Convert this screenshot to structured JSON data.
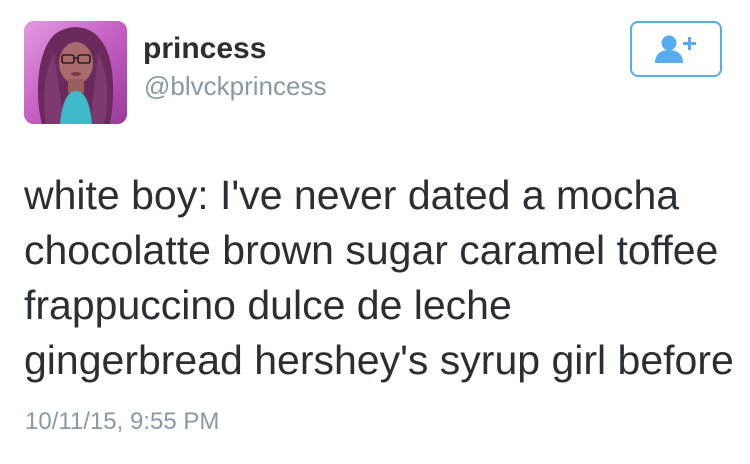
{
  "user": {
    "display_name": "princess",
    "handle": "@blvckprincess",
    "avatar_icon": "profile-photo"
  },
  "follow_button": {
    "icon": "add-user-icon",
    "color": "#55acee"
  },
  "tweet": {
    "text": "white boy: I've never dated a mocha\nchocolatte brown sugar caramel toffee\nfrappuccino dulce de leche\ngingerbread hershey's syrup girl before",
    "timestamp": "10/11/15, 9:55 PM"
  },
  "colors": {
    "text_primary": "#292f33",
    "text_secondary": "#8899a6",
    "accent": "#55acee"
  }
}
